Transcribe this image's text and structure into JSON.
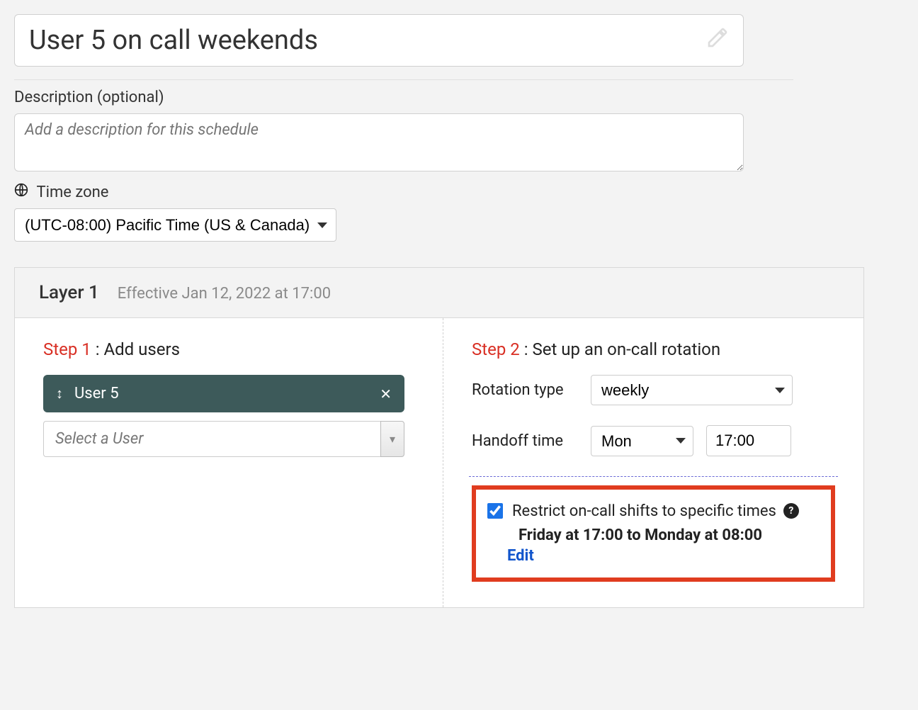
{
  "title": "User 5 on call weekends",
  "description_label": "Description (optional)",
  "description_placeholder": "Add a description for this schedule",
  "timezone_label": "Time zone",
  "timezone_value": "(UTC-08:00) Pacific Time (US & Canada)",
  "layer": {
    "title": "Layer 1",
    "effective": "Effective Jan 12, 2022 at 17:00",
    "step1_num": "Step 1",
    "step1_text": " : Add users",
    "step2_num": "Step 2",
    "step2_text": " : Set up an on-call rotation",
    "user_chip": "User 5",
    "user_select_placeholder": "Select a User",
    "rotation_type_label": "Rotation type",
    "rotation_type_value": "weekly",
    "handoff_label": "Handoff time",
    "handoff_day": "Mon",
    "handoff_time": "17:00",
    "restrict_label": "Restrict on-call shifts to specific times",
    "restrict_detail": "Friday at 17:00 to Monday at 08:00",
    "edit_label": "Edit"
  }
}
